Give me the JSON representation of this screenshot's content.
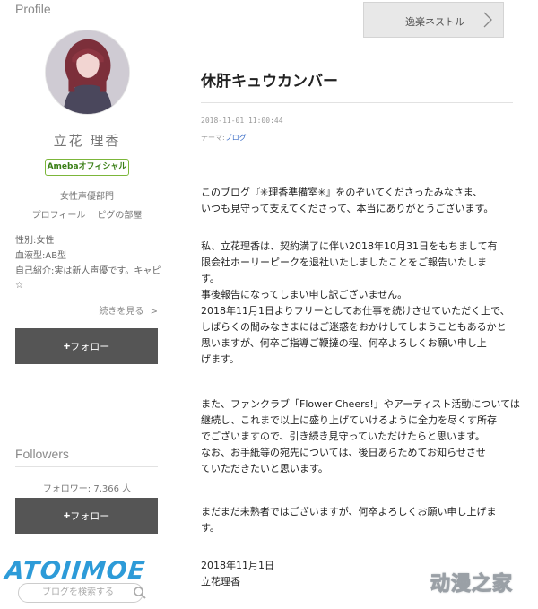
{
  "sidebar": {
    "profile_heading": "Profile",
    "name": "立花 理香",
    "badge": "Amebaオフィシャル",
    "occupation": "女性声優部門",
    "links": [
      "プロフィール",
      "ピグの部屋"
    ],
    "details": [
      "性別:女性",
      "血液型:AB型",
      "自己紹介:実は新人声優です。キャピ☆"
    ],
    "read_more": "続きを見る",
    "follow_label": "フォロー",
    "followers_heading": "Followers",
    "follower_count": "フォロワー: 7,366 人",
    "search_placeholder": "ブログを検索する"
  },
  "nav": {
    "next_entry": "逸楽ネストル"
  },
  "entry": {
    "title": "休肝キュウカンバー",
    "date": "2018-11-01 11:00:44",
    "theme_label": "テーマ:",
    "theme_value": "ブログ",
    "paragraphs": [
      [
        "このブログ『✳︎理香準備室✳︎』をのぞいてくださったみなさま、",
        "いつも見守って支えてくださって、本当にありがとうございます。"
      ],
      [
        "私、立花理香は、契約満了に伴い2018年10月31日をもちまして有",
        "限会社ホーリーピークを退社いたしましたことをご報告いたしま",
        "す。",
        "事後報告になってしまい申し訳ございません。",
        "2018年11月1日よりフリーとしてお仕事を続けさせていただく上で、",
        "しばらくの間みなさまにはご迷惑をおかけしてしまうこともあるかと",
        "思いますが、何卒ご指導ご鞭撻の程、何卒よろしくお願い申し上",
        "げます。"
      ],
      [
        "また、ファンクラブ「Flower Cheers!」やアーティスト活動については",
        "継続し、これまで以上に盛り上げていけるように全力を尽くす所存",
        "でございますので、引き続き見守っていただけたらと思います。",
        "なお、お手紙等の宛先については、後日あらためてお知らせさせ",
        "ていただきたいと思います。"
      ],
      [
        "まだまだ未熟者ではございますが、何卒よろしくお願い申し上げま",
        "す。"
      ],
      [
        "2018年11月1日",
        "立花理香"
      ]
    ]
  },
  "watermarks": {
    "left": "ATOIIMOE",
    "right": "动漫之家"
  },
  "icons": [
    "chevron-right-icon",
    "search-icon",
    "plus-icon"
  ]
}
